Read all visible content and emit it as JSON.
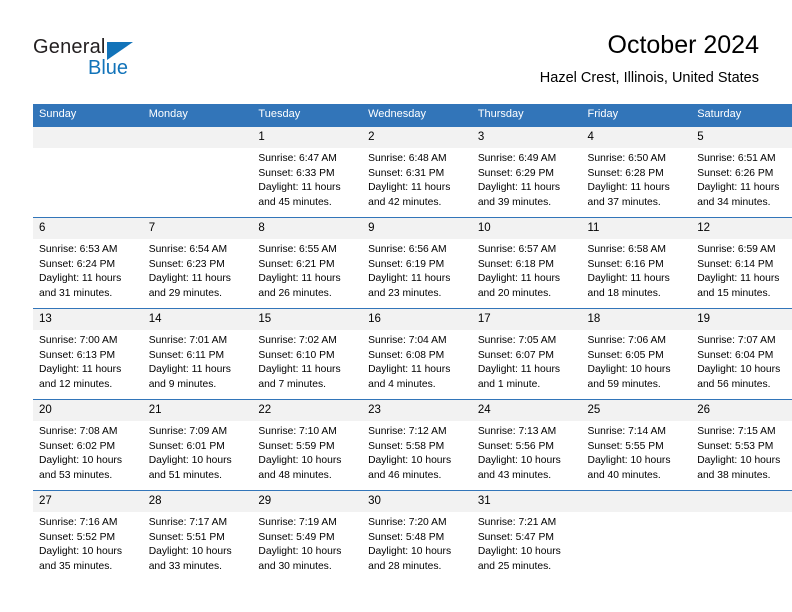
{
  "brand": {
    "name_part1": "General",
    "name_part2": "Blue",
    "accent_color": "#1273b9"
  },
  "header": {
    "title": "October 2024",
    "subtitle": "Hazel Crest, Illinois, United States",
    "header_bg_color": "#3275b9"
  },
  "weekdays": [
    "Sunday",
    "Monday",
    "Tuesday",
    "Wednesday",
    "Thursday",
    "Friday",
    "Saturday"
  ],
  "labels": {
    "sunrise": "Sunrise:",
    "sunset": "Sunset:",
    "daylight": "Daylight:"
  },
  "weeks": [
    [
      {
        "day": ""
      },
      {
        "day": ""
      },
      {
        "day": "1",
        "sunrise": "Sunrise: 6:47 AM",
        "sunset": "Sunset: 6:33 PM",
        "daylight_line1": "Daylight: 11 hours",
        "daylight_line2": "and 45 minutes."
      },
      {
        "day": "2",
        "sunrise": "Sunrise: 6:48 AM",
        "sunset": "Sunset: 6:31 PM",
        "daylight_line1": "Daylight: 11 hours",
        "daylight_line2": "and 42 minutes."
      },
      {
        "day": "3",
        "sunrise": "Sunrise: 6:49 AM",
        "sunset": "Sunset: 6:29 PM",
        "daylight_line1": "Daylight: 11 hours",
        "daylight_line2": "and 39 minutes."
      },
      {
        "day": "4",
        "sunrise": "Sunrise: 6:50 AM",
        "sunset": "Sunset: 6:28 PM",
        "daylight_line1": "Daylight: 11 hours",
        "daylight_line2": "and 37 minutes."
      },
      {
        "day": "5",
        "sunrise": "Sunrise: 6:51 AM",
        "sunset": "Sunset: 6:26 PM",
        "daylight_line1": "Daylight: 11 hours",
        "daylight_line2": "and 34 minutes."
      }
    ],
    [
      {
        "day": "6",
        "sunrise": "Sunrise: 6:53 AM",
        "sunset": "Sunset: 6:24 PM",
        "daylight_line1": "Daylight: 11 hours",
        "daylight_line2": "and 31 minutes."
      },
      {
        "day": "7",
        "sunrise": "Sunrise: 6:54 AM",
        "sunset": "Sunset: 6:23 PM",
        "daylight_line1": "Daylight: 11 hours",
        "daylight_line2": "and 29 minutes."
      },
      {
        "day": "8",
        "sunrise": "Sunrise: 6:55 AM",
        "sunset": "Sunset: 6:21 PM",
        "daylight_line1": "Daylight: 11 hours",
        "daylight_line2": "and 26 minutes."
      },
      {
        "day": "9",
        "sunrise": "Sunrise: 6:56 AM",
        "sunset": "Sunset: 6:19 PM",
        "daylight_line1": "Daylight: 11 hours",
        "daylight_line2": "and 23 minutes."
      },
      {
        "day": "10",
        "sunrise": "Sunrise: 6:57 AM",
        "sunset": "Sunset: 6:18 PM",
        "daylight_line1": "Daylight: 11 hours",
        "daylight_line2": "and 20 minutes."
      },
      {
        "day": "11",
        "sunrise": "Sunrise: 6:58 AM",
        "sunset": "Sunset: 6:16 PM",
        "daylight_line1": "Daylight: 11 hours",
        "daylight_line2": "and 18 minutes."
      },
      {
        "day": "12",
        "sunrise": "Sunrise: 6:59 AM",
        "sunset": "Sunset: 6:14 PM",
        "daylight_line1": "Daylight: 11 hours",
        "daylight_line2": "and 15 minutes."
      }
    ],
    [
      {
        "day": "13",
        "sunrise": "Sunrise: 7:00 AM",
        "sunset": "Sunset: 6:13 PM",
        "daylight_line1": "Daylight: 11 hours",
        "daylight_line2": "and 12 minutes."
      },
      {
        "day": "14",
        "sunrise": "Sunrise: 7:01 AM",
        "sunset": "Sunset: 6:11 PM",
        "daylight_line1": "Daylight: 11 hours",
        "daylight_line2": "and 9 minutes."
      },
      {
        "day": "15",
        "sunrise": "Sunrise: 7:02 AM",
        "sunset": "Sunset: 6:10 PM",
        "daylight_line1": "Daylight: 11 hours",
        "daylight_line2": "and 7 minutes."
      },
      {
        "day": "16",
        "sunrise": "Sunrise: 7:04 AM",
        "sunset": "Sunset: 6:08 PM",
        "daylight_line1": "Daylight: 11 hours",
        "daylight_line2": "and 4 minutes."
      },
      {
        "day": "17",
        "sunrise": "Sunrise: 7:05 AM",
        "sunset": "Sunset: 6:07 PM",
        "daylight_line1": "Daylight: 11 hours",
        "daylight_line2": "and 1 minute."
      },
      {
        "day": "18",
        "sunrise": "Sunrise: 7:06 AM",
        "sunset": "Sunset: 6:05 PM",
        "daylight_line1": "Daylight: 10 hours",
        "daylight_line2": "and 59 minutes."
      },
      {
        "day": "19",
        "sunrise": "Sunrise: 7:07 AM",
        "sunset": "Sunset: 6:04 PM",
        "daylight_line1": "Daylight: 10 hours",
        "daylight_line2": "and 56 minutes."
      }
    ],
    [
      {
        "day": "20",
        "sunrise": "Sunrise: 7:08 AM",
        "sunset": "Sunset: 6:02 PM",
        "daylight_line1": "Daylight: 10 hours",
        "daylight_line2": "and 53 minutes."
      },
      {
        "day": "21",
        "sunrise": "Sunrise: 7:09 AM",
        "sunset": "Sunset: 6:01 PM",
        "daylight_line1": "Daylight: 10 hours",
        "daylight_line2": "and 51 minutes."
      },
      {
        "day": "22",
        "sunrise": "Sunrise: 7:10 AM",
        "sunset": "Sunset: 5:59 PM",
        "daylight_line1": "Daylight: 10 hours",
        "daylight_line2": "and 48 minutes."
      },
      {
        "day": "23",
        "sunrise": "Sunrise: 7:12 AM",
        "sunset": "Sunset: 5:58 PM",
        "daylight_line1": "Daylight: 10 hours",
        "daylight_line2": "and 46 minutes."
      },
      {
        "day": "24",
        "sunrise": "Sunrise: 7:13 AM",
        "sunset": "Sunset: 5:56 PM",
        "daylight_line1": "Daylight: 10 hours",
        "daylight_line2": "and 43 minutes."
      },
      {
        "day": "25",
        "sunrise": "Sunrise: 7:14 AM",
        "sunset": "Sunset: 5:55 PM",
        "daylight_line1": "Daylight: 10 hours",
        "daylight_line2": "and 40 minutes."
      },
      {
        "day": "26",
        "sunrise": "Sunrise: 7:15 AM",
        "sunset": "Sunset: 5:53 PM",
        "daylight_line1": "Daylight: 10 hours",
        "daylight_line2": "and 38 minutes."
      }
    ],
    [
      {
        "day": "27",
        "sunrise": "Sunrise: 7:16 AM",
        "sunset": "Sunset: 5:52 PM",
        "daylight_line1": "Daylight: 10 hours",
        "daylight_line2": "and 35 minutes."
      },
      {
        "day": "28",
        "sunrise": "Sunrise: 7:17 AM",
        "sunset": "Sunset: 5:51 PM",
        "daylight_line1": "Daylight: 10 hours",
        "daylight_line2": "and 33 minutes."
      },
      {
        "day": "29",
        "sunrise": "Sunrise: 7:19 AM",
        "sunset": "Sunset: 5:49 PM",
        "daylight_line1": "Daylight: 10 hours",
        "daylight_line2": "and 30 minutes."
      },
      {
        "day": "30",
        "sunrise": "Sunrise: 7:20 AM",
        "sunset": "Sunset: 5:48 PM",
        "daylight_line1": "Daylight: 10 hours",
        "daylight_line2": "and 28 minutes."
      },
      {
        "day": "31",
        "sunrise": "Sunrise: 7:21 AM",
        "sunset": "Sunset: 5:47 PM",
        "daylight_line1": "Daylight: 10 hours",
        "daylight_line2": "and 25 minutes."
      },
      {
        "day": ""
      },
      {
        "day": ""
      }
    ]
  ]
}
